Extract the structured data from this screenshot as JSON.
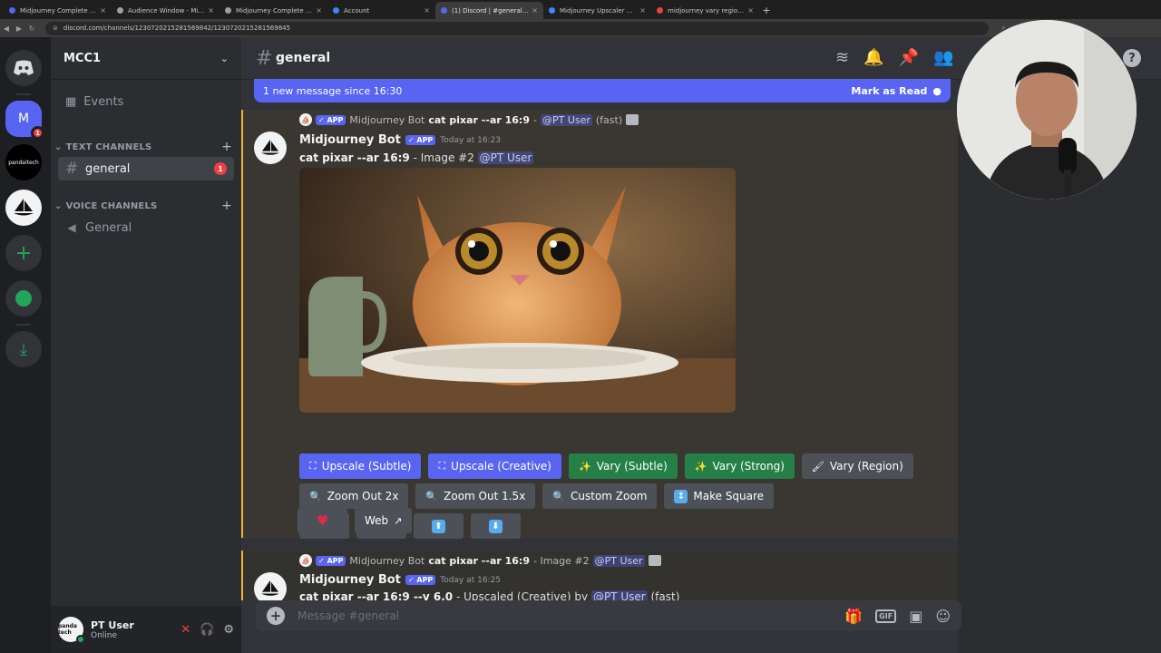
{
  "browser": {
    "tabs": [
      {
        "label": "Midjourney Complete Course",
        "color": "#5865f2",
        "close": "×"
      },
      {
        "label": "Audience Window - Midjourney",
        "color": "#9aa0a6",
        "close": "×"
      },
      {
        "label": "Midjourney Complete Course",
        "color": "#9aa0a6",
        "close": "×"
      },
      {
        "label": "Account",
        "color": "#4285f4",
        "close": "×"
      },
      {
        "label": "(1) Discord | #general | MCC1",
        "color": "#5865f2",
        "close": "×"
      },
      {
        "label": "Midjourney Upscaler Models",
        "color": "#4285f4",
        "close": "×"
      },
      {
        "label": "midjourney vary region not",
        "color": "#ea4335",
        "close": "×"
      }
    ],
    "new_tab": "+",
    "url": "discord.com/channels/1230720215281569842/1230720215281569845"
  },
  "server": {
    "name": "MCC1",
    "rail": [
      {
        "label": "M",
        "badge": "1"
      },
      {
        "label": "pandaitech"
      }
    ]
  },
  "sidebar": {
    "events_label": "Events",
    "text_channels_label": "TEXT CHANNELS",
    "voice_channels_label": "VOICE CHANNELS",
    "channels": [
      {
        "name": "general",
        "badge": "1",
        "selected": true
      }
    ],
    "voice": [
      {
        "name": "General"
      }
    ]
  },
  "user": {
    "name": "PT User",
    "status": "Online",
    "avatar_text": "panda tech"
  },
  "header": {
    "channel": "general"
  },
  "new_messages": {
    "text": "1 new message since 16:30",
    "action": "Mark as Read"
  },
  "messages": [
    {
      "reply_app_tag": "✓ APP",
      "reply_author": "Midjourney Bot",
      "reply_prompt": "cat pixar --ar 16:9",
      "reply_sep": "-",
      "reply_mention": "@PT User",
      "reply_suffix": "(fast)",
      "author": "Midjourney Bot",
      "app_tag": "✓ APP",
      "timestamp": "Today at 16:23",
      "prompt": "cat pixar --ar 16:9",
      "detail": "- Image #2",
      "mention": "@PT User",
      "buttons_row1": [
        {
          "label": "Upscale (Subtle)",
          "icon": "⛶"
        },
        {
          "label": "Upscale (Creative)",
          "icon": "⛶"
        },
        {
          "label": "Vary (Subtle)",
          "icon": "✨"
        },
        {
          "label": "Vary (Strong)",
          "icon": "✨"
        },
        {
          "label": "Vary (Region)",
          "icon": "🖌"
        }
      ],
      "buttons_row2": [
        {
          "label": "Zoom Out 2x",
          "icon": "🔍"
        },
        {
          "label": "Zoom Out 1.5x",
          "icon": "🔍"
        },
        {
          "label": "Custom Zoom",
          "icon": "🔍"
        },
        {
          "label": "Make Square",
          "icon": "↕"
        }
      ],
      "arrows": [
        "⬅",
        "➡",
        "⬆",
        "⬇"
      ],
      "heart": "♥",
      "web_label": "Web",
      "web_icon": "↗"
    },
    {
      "reply_app_tag": "✓ APP",
      "reply_author": "Midjourney Bot",
      "reply_prompt": "cat pixar --ar 16:9",
      "reply_detail": "- Image #2",
      "reply_mention": "@PT User",
      "author": "Midjourney Bot",
      "app_tag": "✓ APP",
      "timestamp": "Today at 16:25",
      "prompt": "cat pixar --ar 16:9 --v 6.0",
      "detail": "- Upscaled (Creative) by",
      "mention": "@PT User",
      "suffix": "(fast)"
    }
  ],
  "composer": {
    "placeholder": "Message #general"
  },
  "colors": {
    "blurple": "#5865f2",
    "green": "#248046",
    "grey_button": "#4e5058",
    "highlight_bar": "#f0b232"
  }
}
